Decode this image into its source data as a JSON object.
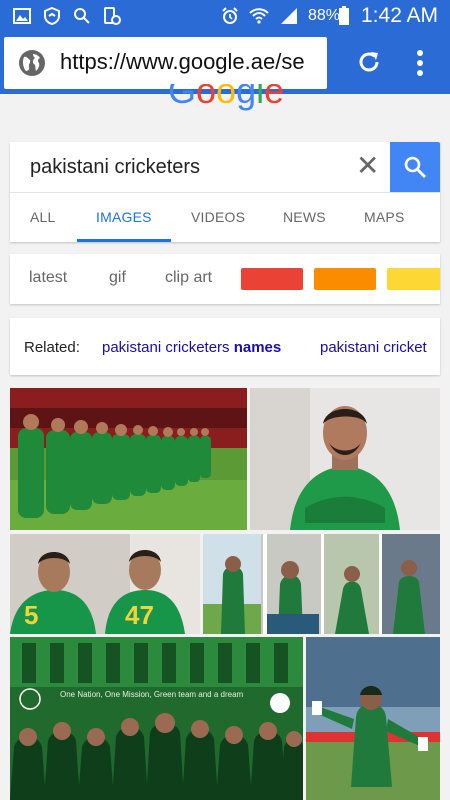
{
  "status_bar": {
    "battery_percent": "88%",
    "time": "1:42 AM"
  },
  "browser": {
    "url": "https://www.google.ae/se"
  },
  "search": {
    "logo_text": "Google",
    "query": "pakistani cricketers",
    "clear_label": "✕"
  },
  "tabs": [
    {
      "label": "ALL"
    },
    {
      "label": "IMAGES"
    },
    {
      "label": "VIDEOS"
    },
    {
      "label": "NEWS"
    },
    {
      "label": "MAPS"
    }
  ],
  "filter_chips": [
    {
      "label": "latest"
    },
    {
      "label": "gif"
    },
    {
      "label": "clip art"
    }
  ],
  "color_chips": [
    "#ea4335",
    "#fb8c00",
    "#fdd835"
  ],
  "related": {
    "label": "Related:",
    "items": [
      {
        "prefix": "pakistani cricketers ",
        "bold": "names"
      },
      {
        "prefix": "pakistani cricket",
        "bold": ""
      }
    ]
  },
  "results": {
    "overlay_text": "One Nation, One Mission, Green team and a dream"
  },
  "colors": {
    "browser_blue": "#2b6bd6",
    "accent": "#1a73e8",
    "link": "#1a0dab"
  }
}
